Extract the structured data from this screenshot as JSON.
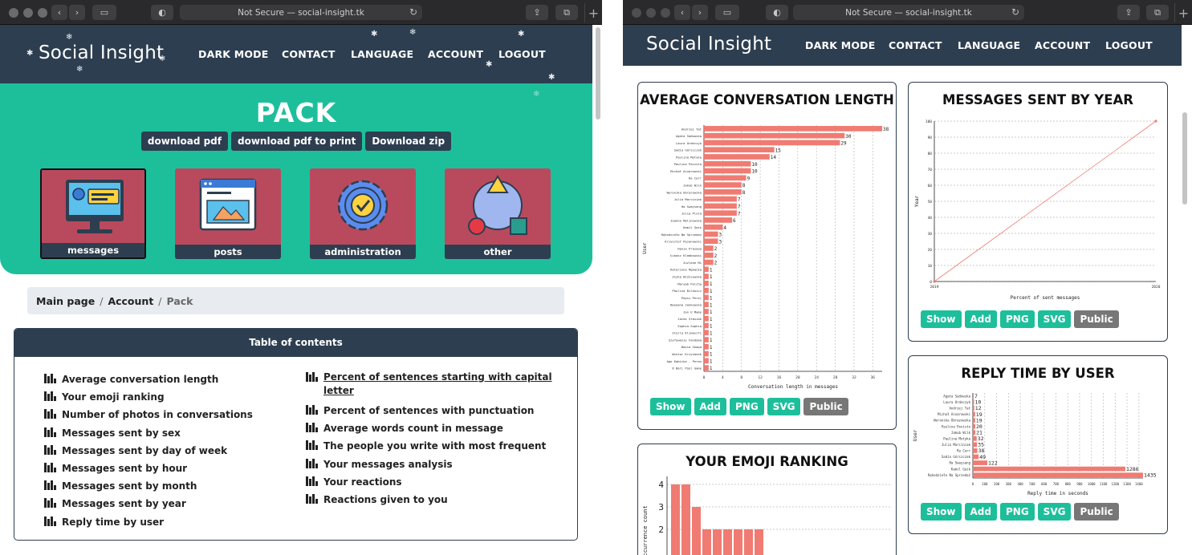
{
  "browser": {
    "left_url": "Not Secure — social-insight.tk",
    "right_url": "Not Secure — social-insight.tk"
  },
  "nav": {
    "brand": "Social Insight",
    "links": [
      "DARK MODE",
      "CONTACT",
      "LANGUAGE",
      "ACCOUNT",
      "LOGOUT"
    ]
  },
  "colors": {
    "navy": "#2d3e50",
    "teal": "#1dbf9b",
    "card": "#b94a5e",
    "bar": "#f07b72"
  },
  "pack": {
    "title": "PACK",
    "downloads": [
      "download pdf",
      "download pdf to print",
      "Download zip"
    ],
    "cards": [
      {
        "label": "messages",
        "icon": "monitor-chat-icon"
      },
      {
        "label": "posts",
        "icon": "browser-window-icon"
      },
      {
        "label": "administration",
        "icon": "gear-check-icon"
      },
      {
        "label": "other",
        "icon": "shapes-icon"
      }
    ]
  },
  "breadcrumb": {
    "items": [
      "Main page",
      "Account"
    ],
    "active": "Pack"
  },
  "toc": {
    "title": "Table of contents",
    "left": [
      "Average conversation length",
      "Your emoji ranking",
      "Number of photos in conversations",
      "Messages sent by sex",
      "Messages sent by day of week",
      "Messages sent by hour",
      "Messages sent by month",
      "Messages sent by year",
      "Reply time by user"
    ],
    "right": [
      "Percent of sentences starting with capital",
      "letter",
      "Percent of sentences with punctuation",
      "Average words count in message",
      "The people you write with most frequent",
      "Your messages analysis",
      "Your reactions",
      "Reactions given to you"
    ]
  },
  "actions": [
    "Show",
    "Add",
    "PNG",
    "SVG",
    "Public"
  ],
  "charts": {
    "avg": {
      "title": "AVERAGE CONVERSATION LENGTH",
      "chart_data": {
        "type": "bar",
        "orientation": "horizontal",
        "title": "AVERAGE CONVERSATION LENGTH",
        "xlabel": "Conversation length in messages",
        "ylabel": "User",
        "xlim": [
          0,
          38
        ],
        "xticks": [
          0,
          4,
          8,
          12,
          16,
          20,
          24,
          28,
          32,
          36
        ],
        "categories": [
          "Andrzej Tat",
          "Agata Sadowska",
          "Laura Ordeczyk",
          "Sadia Górszczak",
          "Paulina Motyka",
          "Paulina Penisto",
          "Michał Ainarowski",
          "Ra Carr",
          "Jakub Wilk",
          "Weronika Obrazowska",
          "Julia Marciniak",
          "Ha Swaysang",
          "Julia Pluta",
          "Joanna Malinowska",
          "Kamil Gaik",
          "Rękodzieło Na Sprzedaż",
          "Krzysztof Pajanowski",
          "Hania Prasowa",
          "Łukasz Klamkowski",
          "Zuzlane Mi",
          "Katarzyna Mębacka",
          "Zuzka Wiśniewska",
          "Maryam Pelcha",
          "Paulina Bilewicz",
          "Pepsi Perej",
          "Nyeoana Jankowska",
          "Jan U Mamy",
          "Jacek Stasiak",
          "Sophia Sophia",
          "Stella Klimaszfi",
          "Szyfowanie Fandoma",
          "Basia Skapa",
          "Wiktor Krzyżanek",
          "Ago Kabicka - Peran",
          "8 Ball Pool Game"
        ],
        "values": [
          38,
          30,
          29,
          15,
          14,
          10,
          10,
          9,
          8,
          8,
          7,
          7,
          7,
          6,
          4,
          3,
          3,
          2,
          2,
          2,
          1,
          1,
          1,
          1,
          1,
          1,
          1,
          1,
          1,
          1,
          1,
          1,
          1,
          1,
          1
        ]
      }
    },
    "year": {
      "title": "MESSAGES SENT BY YEAR",
      "chart_data": {
        "type": "line",
        "title": "MESSAGES SENT BY YEAR",
        "xlabel": "Percent of sent messages",
        "ylabel": "Year",
        "x": [
          2019,
          2020
        ],
        "y": [
          0,
          100
        ],
        "ylim": [
          0,
          100
        ],
        "yticks": [
          0,
          10,
          20,
          30,
          40,
          50,
          60,
          70,
          80,
          90,
          100
        ]
      }
    },
    "reply": {
      "title": "REPLY TIME BY USER",
      "chart_data": {
        "type": "bar",
        "orientation": "horizontal",
        "title": "REPLY TIME BY USER",
        "xlabel": "Reply time in seconds",
        "ylabel": "User",
        "xlim": [
          0,
          1435
        ],
        "xticks": [
          0,
          100,
          200,
          300,
          400,
          500,
          600,
          700,
          800,
          900,
          1000,
          1100,
          1200,
          1300,
          1400
        ],
        "categories": [
          "Agata Sadowska",
          "Laura Ordeczyk",
          "Andrzej Tat",
          "Michał Ainarowski",
          "Weronika Obrazowska",
          "Paulina Penisto",
          "Jakub Wilk",
          "Paulina Motyka",
          "Julia Marciniak",
          "Ra Carr",
          "Sadia Górszczak",
          "Ha Swaysang",
          "Kamil Gaik",
          "Rękodzieło Na Sprzedaż"
        ],
        "values": [
          7,
          10,
          12,
          19,
          19,
          20,
          21,
          32,
          35,
          38,
          49,
          122,
          1286,
          1435
        ]
      }
    },
    "emoji": {
      "title": "YOUR EMOJI RANKING",
      "chart_data": {
        "type": "bar",
        "ylabel": "Occurrence count",
        "yticks": [
          2,
          3,
          4
        ],
        "values": [
          4,
          4,
          3,
          2,
          2,
          2,
          2,
          2,
          2
        ]
      }
    }
  }
}
